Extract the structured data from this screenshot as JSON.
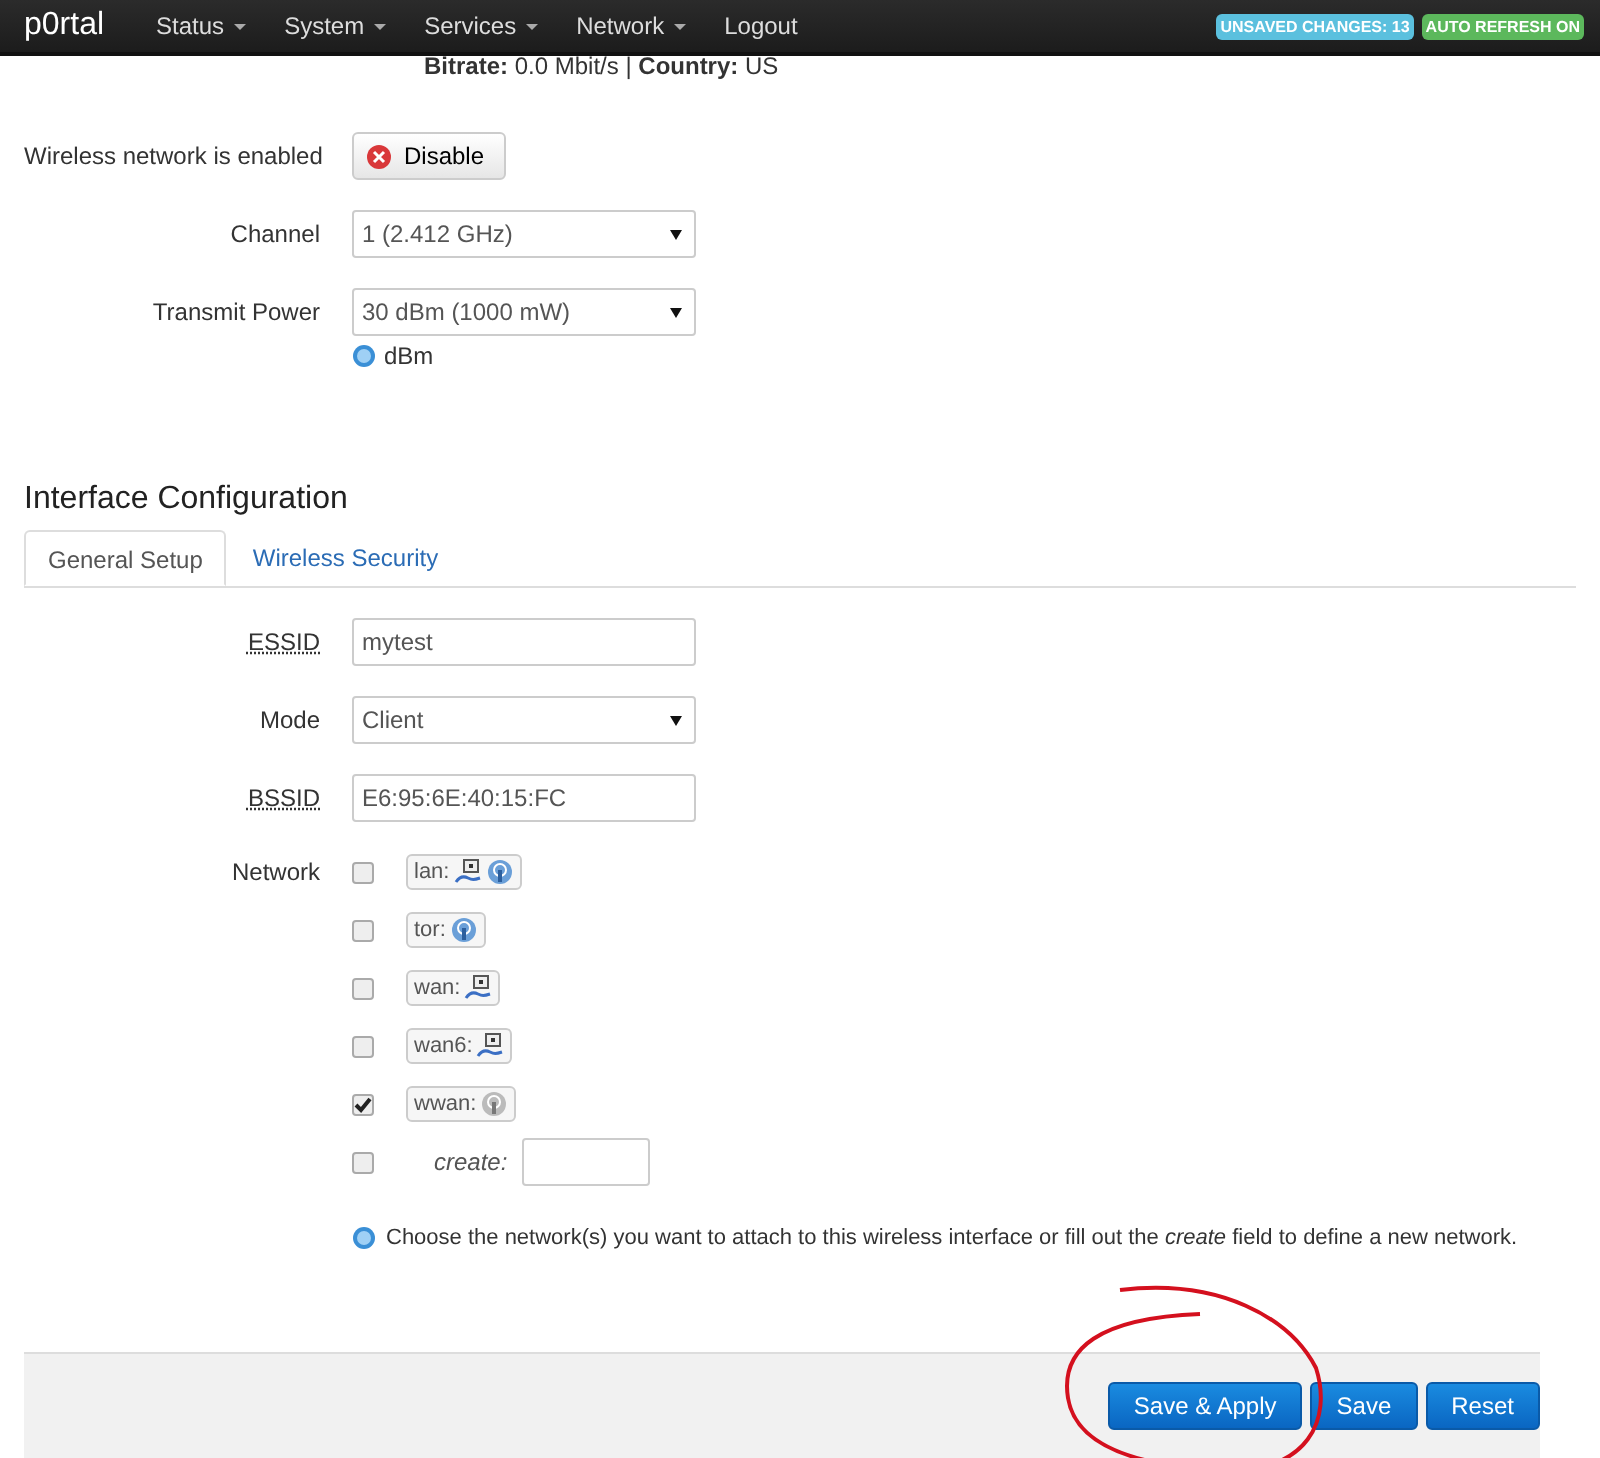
{
  "navbar": {
    "brand": "p0rtal",
    "menus": [
      {
        "label": "Status",
        "dropdown": true
      },
      {
        "label": "System",
        "dropdown": true
      },
      {
        "label": "Services",
        "dropdown": true
      },
      {
        "label": "Network",
        "dropdown": true
      },
      {
        "label": "Logout",
        "dropdown": false
      }
    ],
    "badges": [
      {
        "label": "UNSAVED CHANGES: 13",
        "color": "#5bc0de"
      },
      {
        "label": "AUTO REFRESH ON",
        "color": "#5cb85c"
      }
    ]
  },
  "status_line": "**Bitrate:** 0.0 Mbit/s | **Country:** US",
  "device": {
    "enabled_label": "Wireless network is enabled",
    "toggle_button": "Disable",
    "channel": {
      "label": "Channel",
      "value": "1 (2.412 GHz)"
    },
    "power": {
      "label": "Transmit Power",
      "value": "30 dBm (1000 mW)",
      "hint": "dBm"
    }
  },
  "section_title": "Interface Configuration",
  "tabs": [
    {
      "label": "General Setup",
      "selected": true
    },
    {
      "label": "Wireless Security",
      "selected": false
    }
  ],
  "fields": [
    {
      "kind": "text",
      "label": "ESSID",
      "value": "mytest"
    },
    {
      "kind": "select",
      "label": "Mode",
      "value": "Client"
    },
    {
      "kind": "text",
      "label": "BSSID",
      "value": "E6:95:6E:40:15:FC"
    }
  ],
  "network": {
    "label": "Network",
    "options": [
      {
        "kind": "net",
        "name": "lan:",
        "checked": false,
        "icons": [
          {
            "kind": "wired"
          },
          {
            "kind": "wireless"
          }
        ]
      },
      {
        "kind": "net",
        "name": "tor:",
        "checked": false,
        "icons": [
          {
            "kind": "wireless"
          }
        ]
      },
      {
        "kind": "net",
        "name": "wan:",
        "checked": false,
        "icons": [
          {
            "kind": "wired"
          }
        ]
      },
      {
        "kind": "net",
        "name": "wan6:",
        "checked": false,
        "icons": [
          {
            "kind": "wired"
          }
        ]
      },
      {
        "kind": "net",
        "name": "wwan:",
        "checked": true,
        "icons": [
          {
            "kind": "wireless-grey"
          }
        ]
      },
      {
        "kind": "create",
        "name": "create:",
        "checked": false
      }
    ],
    "help": "Choose the network(s) you want to attach to this wireless interface or fill out the *create* field to define a new network."
  },
  "actions": [
    "Save & Apply",
    "Save",
    "Reset"
  ]
}
